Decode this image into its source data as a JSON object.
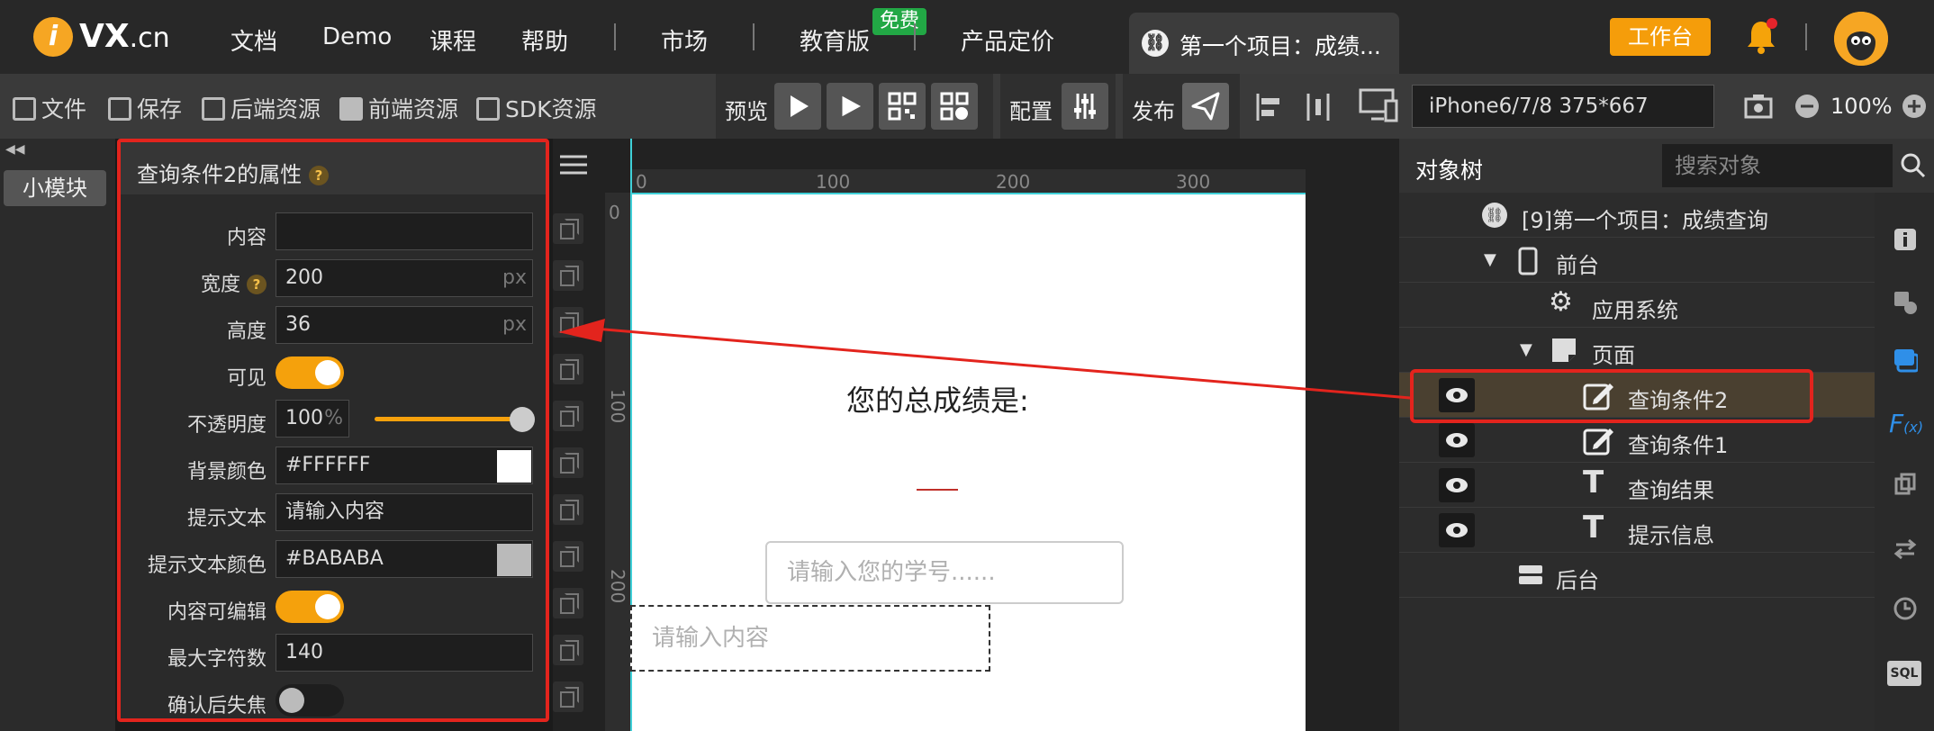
{
  "nav": {
    "logo_letter": "i",
    "logo_text": "VX",
    "logo_suffix": ".cn",
    "items": [
      "文档",
      "Demo",
      "课程",
      "帮助",
      "市场",
      "教育版",
      "产品定价"
    ],
    "free_badge": "免费",
    "project_tab": "第一个项目：成绩...",
    "workbench": "工作台"
  },
  "toolbar": {
    "file": "文件",
    "save": "保存",
    "backend_res": "后端资源",
    "frontend_res": "前端资源",
    "sdk_res": "SDK资源",
    "preview": "预览",
    "config": "配置",
    "publish": "发布",
    "device": "iPhone6/7/8 375*667",
    "zoom": "100%"
  },
  "leftbar": {
    "module_button": "小模块"
  },
  "props": {
    "title": "查询条件2的属性",
    "rows": {
      "content_label": "内容",
      "content_value": "",
      "width_label": "宽度",
      "width_value": "200",
      "width_unit": "px",
      "height_label": "高度",
      "height_value": "36",
      "height_unit": "px",
      "visible_label": "可见",
      "opacity_label": "不透明度",
      "opacity_value": "100",
      "opacity_unit": "%",
      "bg_label": "背景颜色",
      "bg_value": "#FFFFFF",
      "hint_label": "提示文本",
      "hint_value": "请输入内容",
      "hint_color_label": "提示文本颜色",
      "hint_color_value": "#BABABA",
      "editable_label": "内容可编辑",
      "maxlen_label": "最大字符数",
      "maxlen_value": "140",
      "blur_label": "确认后失焦"
    },
    "states": {
      "visible": true,
      "editable": true,
      "blur_on_confirm": false,
      "opacity_level": 1.0
    }
  },
  "canvas": {
    "ruler_h": [
      "0",
      "100",
      "200",
      "300"
    ],
    "ruler_v": [
      "0",
      "100",
      "200"
    ],
    "total_label": "您的总成绩是:",
    "input1_placeholder": "请输入您的学号......",
    "input2_placeholder": "请输入内容"
  },
  "tree": {
    "title": "对象树",
    "search_placeholder": "搜索对象",
    "project": "[9]第一个项目：成绩查询",
    "frontend": "前台",
    "app_system": "应用系统",
    "page": "页面",
    "items": [
      "查询条件2",
      "查询条件1",
      "查询结果",
      "提示信息"
    ],
    "backend": "后台"
  },
  "colors": {
    "accent": "#f59d0a",
    "highlight": "#e3241d",
    "link_blue": "#2f8fe8"
  }
}
